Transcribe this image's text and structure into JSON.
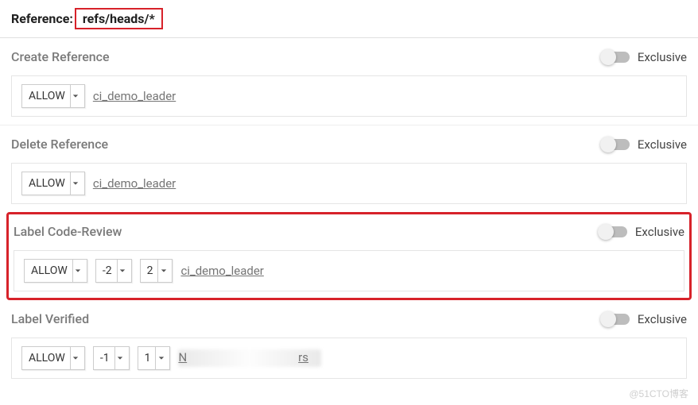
{
  "reference": {
    "label": "Reference:",
    "value": "refs/heads/*"
  },
  "exclusive_label": "Exclusive",
  "sections": {
    "create_reference": {
      "title": "Create Reference",
      "action": "ALLOW",
      "group": "ci_demo_leader"
    },
    "delete_reference": {
      "title": "Delete Reference",
      "action": "ALLOW",
      "group": "ci_demo_leader"
    },
    "label_code_review": {
      "title": "Label Code-Review",
      "action": "ALLOW",
      "min": "-2",
      "max": "2",
      "group": "ci_demo_leader"
    },
    "label_verified": {
      "title": "Label Verified",
      "action": "ALLOW",
      "min": "-1",
      "max": "1",
      "group_prefix": "N",
      "group_suffix": "rs"
    }
  },
  "watermark": "@51CTO博客"
}
